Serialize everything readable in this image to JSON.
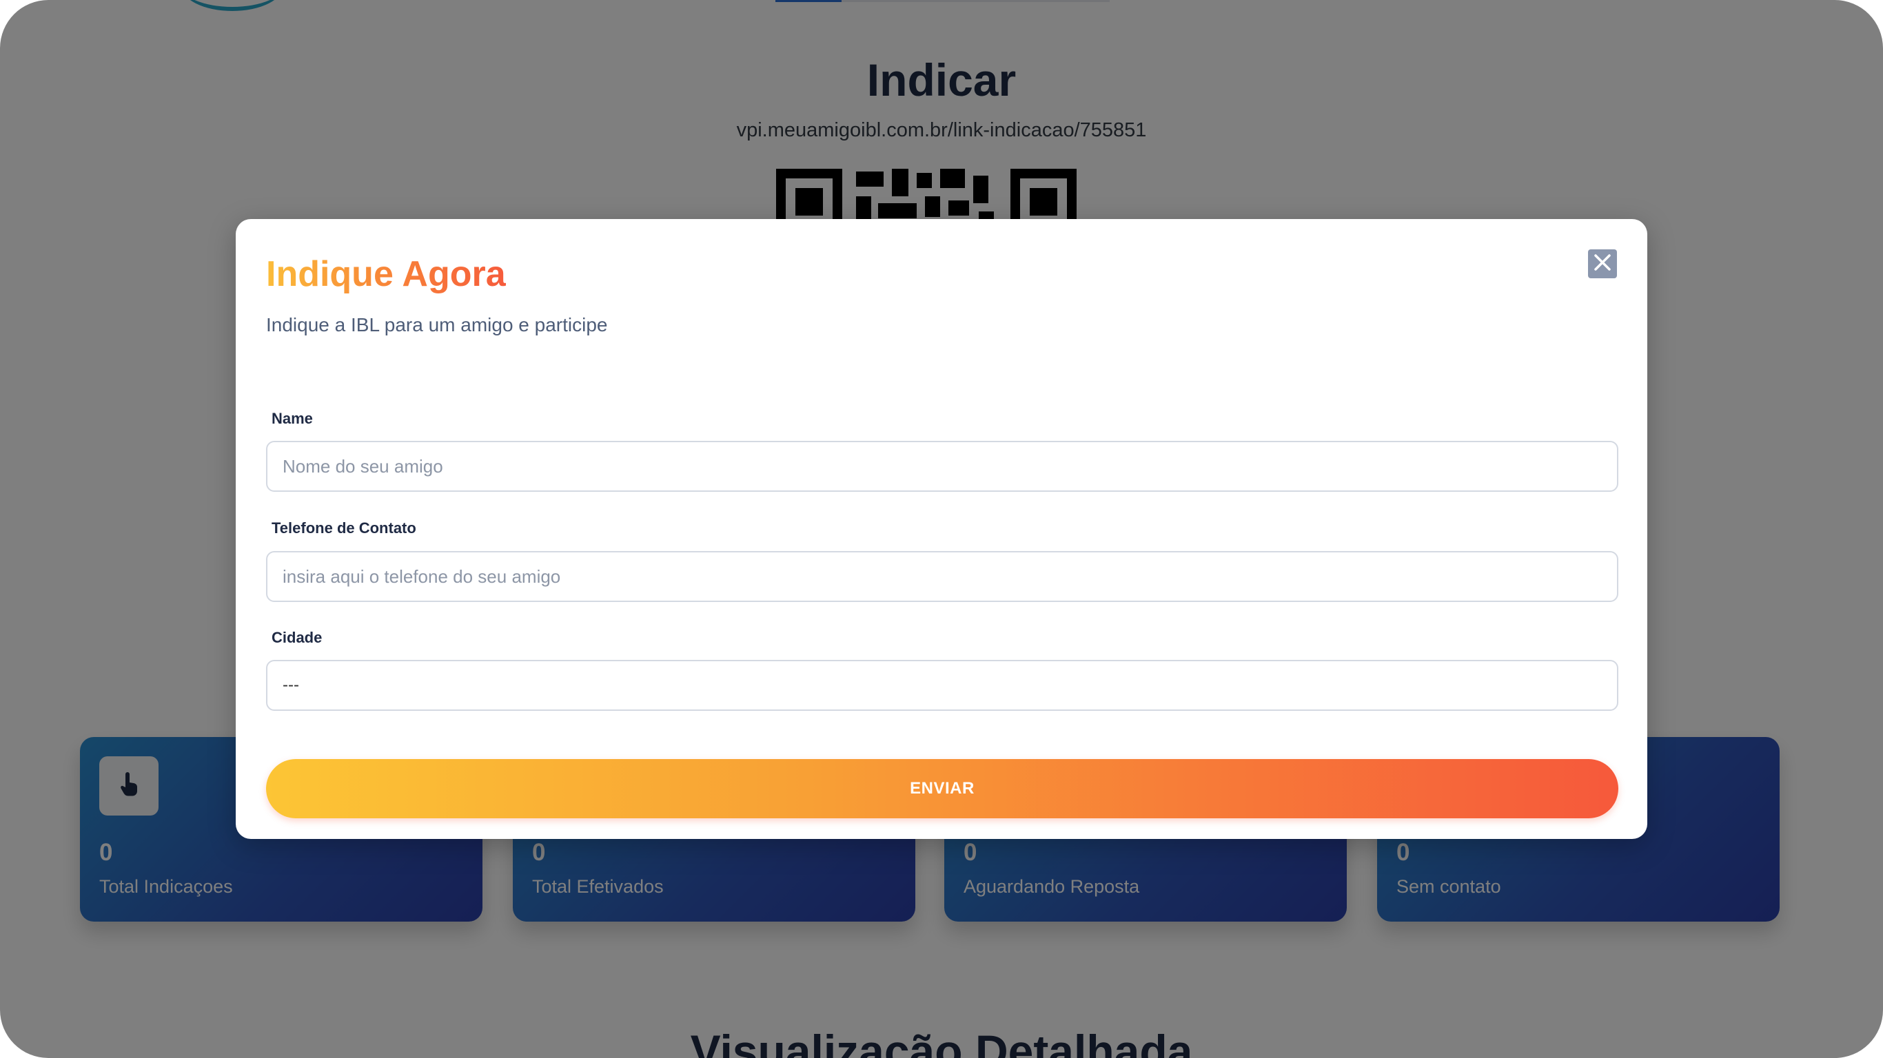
{
  "background": {
    "title": "Indicar",
    "referral_link": "vpi.meuamigoibl.com.br/link-indicacao/755851",
    "cards": [
      {
        "value": "0",
        "label": "Total Indicaçoes",
        "icon": "pointer-hand-icon"
      },
      {
        "value": "0",
        "label": "Total Efetivados"
      },
      {
        "value": "0",
        "label": "Aguardando Reposta"
      },
      {
        "value": "0",
        "label": "Sem contato"
      }
    ],
    "section_title": "Visualização Detalhada"
  },
  "modal": {
    "title": "Indique Agora",
    "subtitle": "Indique a IBL para um amigo e participe",
    "close_icon": "close-icon",
    "fields": {
      "name": {
        "label": "Name",
        "placeholder": "Nome do seu amigo",
        "value": ""
      },
      "phone": {
        "label": "Telefone de Contato",
        "placeholder": "insira aqui o telefone do seu amigo",
        "value": ""
      },
      "city": {
        "label": "Cidade",
        "selected": "---"
      }
    },
    "submit_label": "ENVIAR"
  },
  "colors": {
    "title_gradient": [
      "#fbbd3a",
      "#f65b3b"
    ],
    "button_gradient": [
      "#fcc535",
      "#f6593b"
    ],
    "card_gradient": [
      "#2a8fd2",
      "#2b3fa8"
    ],
    "overlay": "rgba(0,0,0,0.5)"
  }
}
